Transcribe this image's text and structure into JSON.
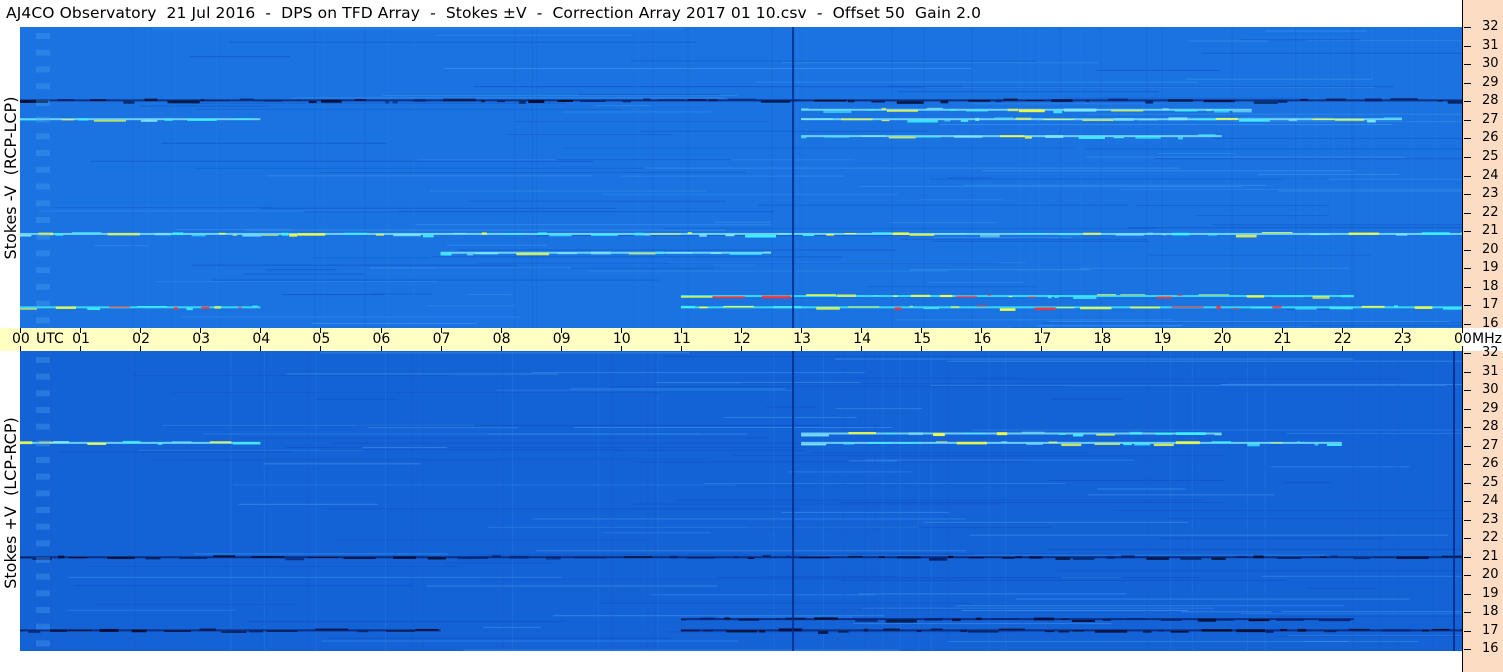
{
  "title": "AJ4CO Observatory  21 Jul 2016  -  DPS on TFD Array  -  Stokes ±V  -  Correction Array 2017 01 10.csv  -  Offset 50  Gain 2.0",
  "colors": {
    "title_bg": "#ffffff",
    "time_axis_bg": "#ffffc4",
    "freq_axis_bg": "#fddcc4",
    "spectrogram_base_top": "#1a73e0",
    "spectrogram_base_bottom": "#1463d6",
    "emission_cyan": "#3ff0ff",
    "emission_yellow": "#f4ff40",
    "emission_red": "#ff3030",
    "absorption_dark": "#000e3a"
  },
  "chart_data": [
    {
      "type": "heatmap",
      "panel": "top",
      "ylabel": "Stokes -V  (RCP-LCP)",
      "xlabel": "",
      "x_unit": "UTC",
      "y_unit": "MHz",
      "xlim": [
        0,
        24
      ],
      "ylim": [
        16,
        32
      ],
      "x_ticks": [
        "00",
        "01",
        "02",
        "03",
        "04",
        "05",
        "06",
        "07",
        "08",
        "09",
        "10",
        "11",
        "12",
        "13",
        "14",
        "15",
        "16",
        "17",
        "18",
        "19",
        "20",
        "21",
        "22",
        "23",
        "00"
      ],
      "y_ticks": [
        "32",
        "31",
        "30",
        "29",
        "28",
        "27",
        "26",
        "25",
        "24",
        "23",
        "22",
        "21",
        "20",
        "19",
        "18",
        "17",
        "16"
      ],
      "features": [
        {
          "kind": "band",
          "t_start": 11.0,
          "t_end": 22.2,
          "f_mhz": 17.7,
          "level": "high"
        },
        {
          "kind": "band",
          "t_start": 11.0,
          "t_end": 24.0,
          "f_mhz": 17.1,
          "level": "high"
        },
        {
          "kind": "band",
          "t_start": 0.0,
          "t_end": 4.0,
          "f_mhz": 17.1,
          "level": "high"
        },
        {
          "kind": "band",
          "t_start": 0.0,
          "t_end": 4.0,
          "f_mhz": 27.1,
          "level": "mid"
        },
        {
          "kind": "band",
          "t_start": 13.0,
          "t_end": 23.0,
          "f_mhz": 27.1,
          "level": "mid"
        },
        {
          "kind": "band",
          "t_start": 13.0,
          "t_end": 20.5,
          "f_mhz": 27.6,
          "level": "mid"
        },
        {
          "kind": "band",
          "t_start": 13.0,
          "t_end": 20.0,
          "f_mhz": 26.2,
          "level": "mid"
        },
        {
          "kind": "band",
          "t_start": 7.0,
          "t_end": 12.5,
          "f_mhz": 20.0,
          "level": "mid"
        },
        {
          "kind": "band",
          "t_start": 0.0,
          "t_end": 24.0,
          "f_mhz": 21.0,
          "level": "mid"
        },
        {
          "kind": "band",
          "t_start": 0.0,
          "t_end": 24.0,
          "f_mhz": 28.1,
          "level": "low"
        },
        {
          "kind": "vline",
          "t": 12.85,
          "f_min": 16,
          "f_max": 32,
          "level": "low"
        }
      ]
    },
    {
      "type": "heatmap",
      "panel": "bottom",
      "ylabel": "Stokes +V  (LCP-RCP)",
      "xlabel": "",
      "x_unit": "UTC",
      "y_unit": "MHz",
      "xlim": [
        0,
        24
      ],
      "ylim": [
        16,
        32
      ],
      "x_ticks": [
        "00",
        "01",
        "02",
        "03",
        "04",
        "05",
        "06",
        "07",
        "08",
        "09",
        "10",
        "11",
        "12",
        "13",
        "14",
        "15",
        "16",
        "17",
        "18",
        "19",
        "20",
        "21",
        "22",
        "23",
        "00"
      ],
      "y_ticks": [
        "32",
        "31",
        "30",
        "29",
        "28",
        "27",
        "26",
        "25",
        "24",
        "23",
        "22",
        "21",
        "20",
        "19",
        "18",
        "17",
        "16"
      ],
      "features": [
        {
          "kind": "band",
          "t_start": 11.0,
          "t_end": 22.2,
          "f_mhz": 17.7,
          "level": "low"
        },
        {
          "kind": "band",
          "t_start": 11.0,
          "t_end": 24.0,
          "f_mhz": 17.1,
          "level": "low"
        },
        {
          "kind": "band",
          "t_start": 0.0,
          "t_end": 7.0,
          "f_mhz": 17.1,
          "level": "low"
        },
        {
          "kind": "band",
          "t_start": 0.0,
          "t_end": 4.0,
          "f_mhz": 27.1,
          "level": "mid"
        },
        {
          "kind": "band",
          "t_start": 13.0,
          "t_end": 22.0,
          "f_mhz": 27.1,
          "level": "mid"
        },
        {
          "kind": "band",
          "t_start": 13.0,
          "t_end": 20.0,
          "f_mhz": 27.6,
          "level": "mid"
        },
        {
          "kind": "band",
          "t_start": 0.0,
          "t_end": 24.0,
          "f_mhz": 21.0,
          "level": "low"
        },
        {
          "kind": "vline",
          "t": 12.85,
          "f_min": 16,
          "f_max": 32,
          "level": "low"
        },
        {
          "kind": "vline",
          "t": 23.85,
          "f_min": 16,
          "f_max": 32,
          "level": "low"
        }
      ]
    }
  ],
  "time_axis": {
    "utc_label": "UTC",
    "mhz_label": "MHz"
  }
}
